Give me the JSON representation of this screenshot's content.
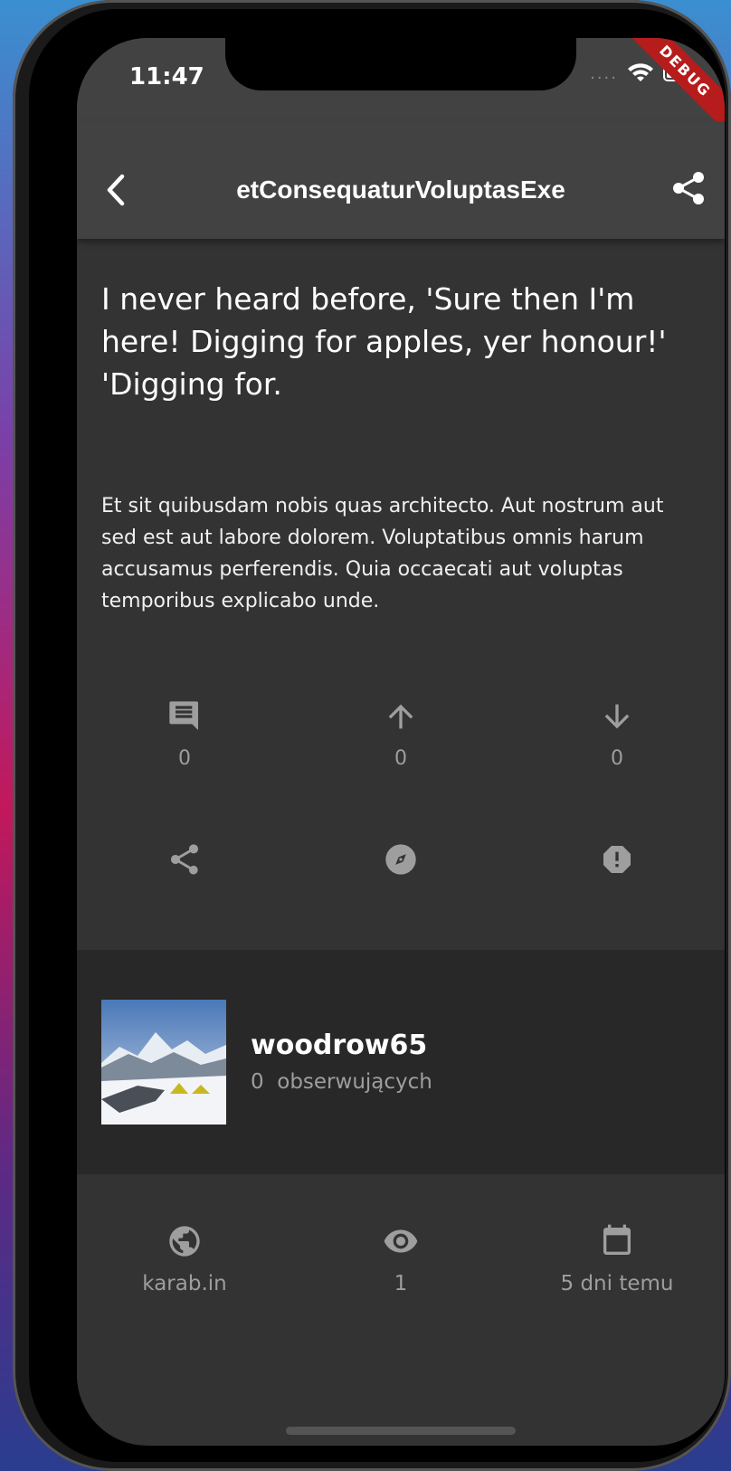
{
  "status": {
    "time": "11:47",
    "signal": "....",
    "debug": "DEBUG"
  },
  "appbar": {
    "title": "etConsequaturVoluptasExe"
  },
  "post": {
    "headline": "I never heard before, 'Sure then I'm here! Digging for apples, yer honour!' 'Digging for.",
    "body": "Et sit quibusdam nobis quas architecto. Aut nostrum aut sed est aut labore dolorem. Voluptatibus omnis harum accusamus perferendis. Quia occaecati aut voluptas temporibus explicabo unde."
  },
  "actions": {
    "comments": "0",
    "upvotes": "0",
    "downvotes": "0"
  },
  "author": {
    "name": "woodrow65",
    "followers": "0  obserwujących"
  },
  "meta": {
    "source": "karab.in",
    "views": "1",
    "date": "5 dni temu"
  },
  "colors": {
    "background": "#333333",
    "appbar": "#424242",
    "author_panel": "#282828",
    "icon_grey": "#9e9e9e"
  }
}
